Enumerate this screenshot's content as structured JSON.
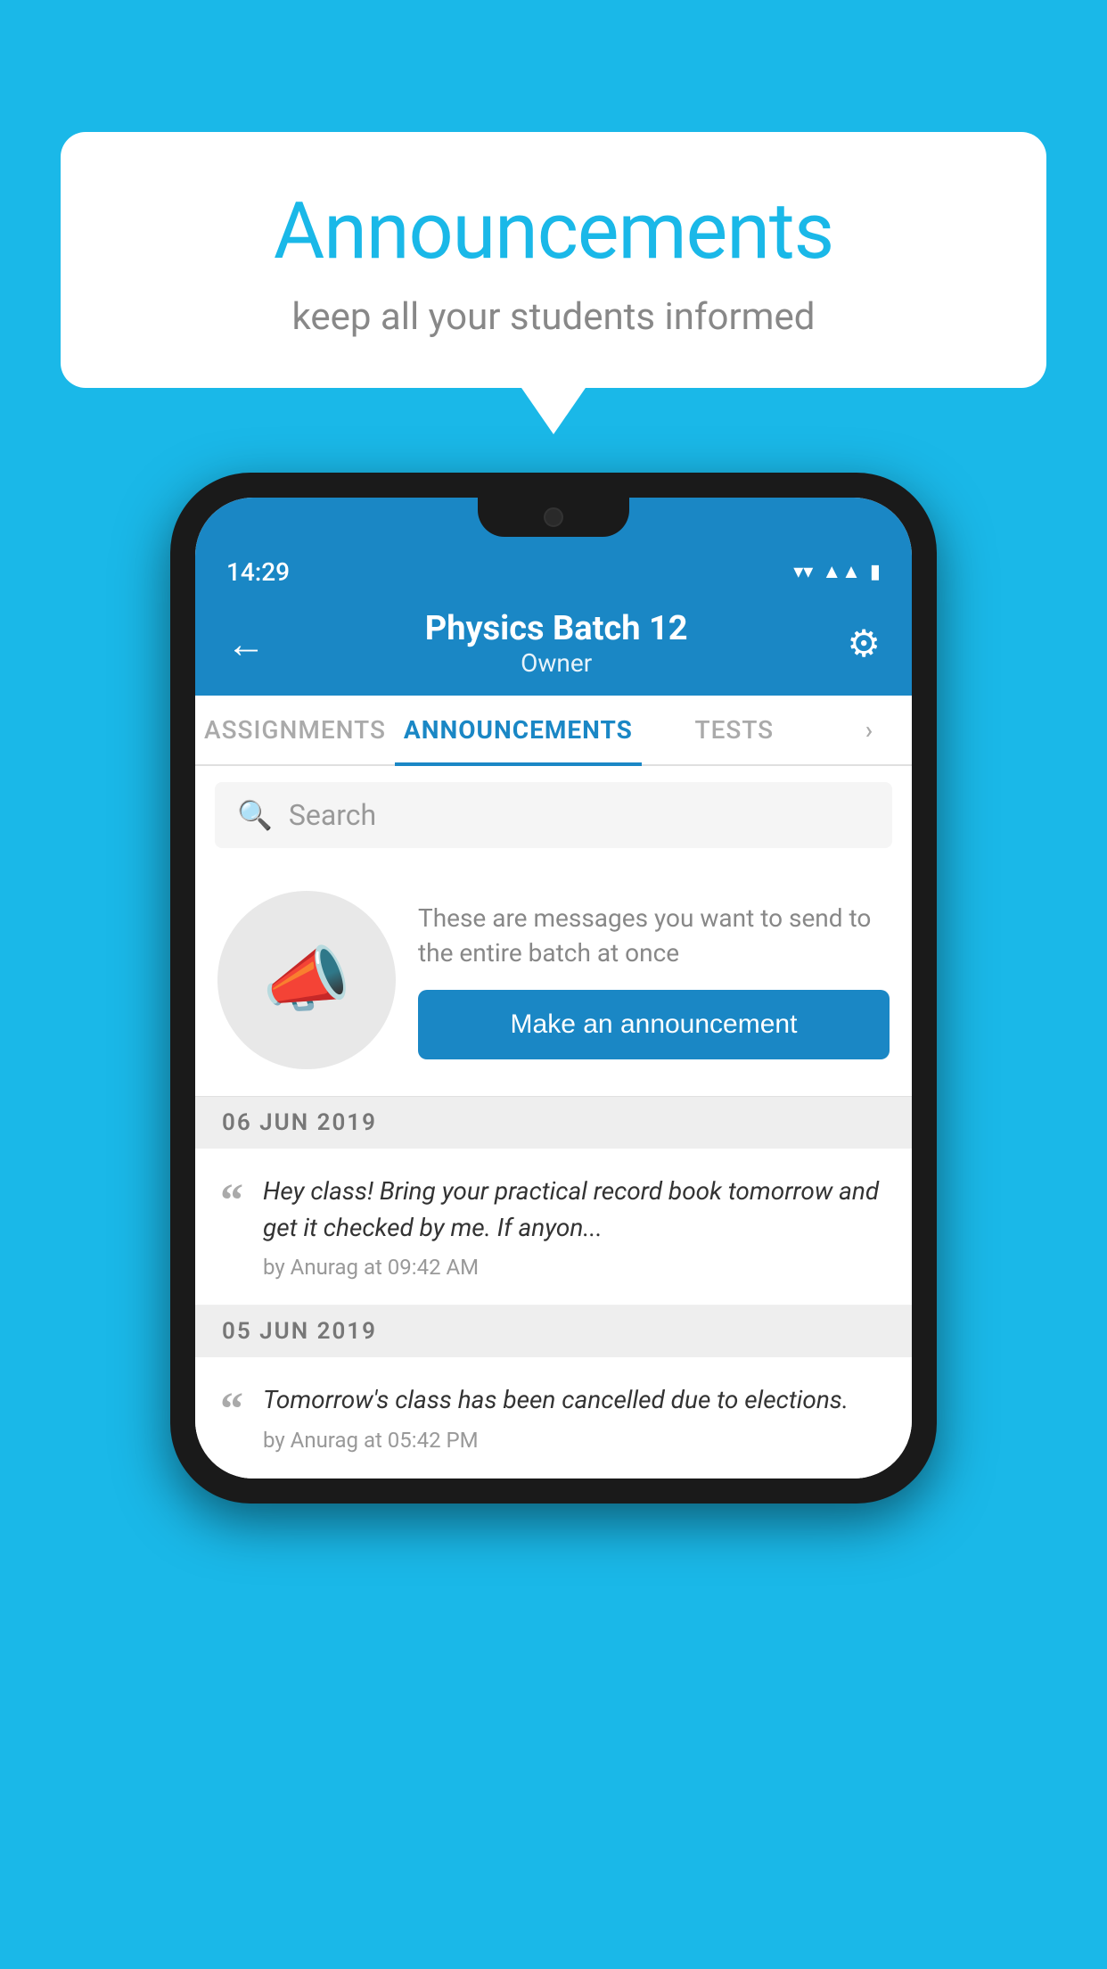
{
  "background": {
    "color": "#1ab8e8"
  },
  "speech_bubble": {
    "title": "Announcements",
    "subtitle": "keep all your students informed"
  },
  "phone": {
    "status_bar": {
      "time": "14:29",
      "icons": [
        "wifi",
        "signal",
        "battery"
      ]
    },
    "header": {
      "title": "Physics Batch 12",
      "subtitle": "Owner",
      "back_label": "←",
      "gear_label": "⚙"
    },
    "tabs": [
      {
        "label": "ASSIGNMENTS",
        "active": false
      },
      {
        "label": "ANNOUNCEMENTS",
        "active": true
      },
      {
        "label": "TESTS",
        "active": false
      },
      {
        "label": "···",
        "active": false
      }
    ],
    "search": {
      "placeholder": "Search"
    },
    "announcement_prompt": {
      "description": "These are messages you want to send to the entire batch at once",
      "button_label": "Make an announcement"
    },
    "date_sections": [
      {
        "date": "06  JUN  2019",
        "items": [
          {
            "message": "Hey class! Bring your practical record book tomorrow and get it checked by me. If anyon...",
            "meta": "by Anurag at 09:42 AM"
          }
        ]
      },
      {
        "date": "05  JUN  2019",
        "items": [
          {
            "message": "Tomorrow's class has been cancelled due to elections.",
            "meta": "by Anurag at 05:42 PM"
          }
        ]
      }
    ]
  }
}
